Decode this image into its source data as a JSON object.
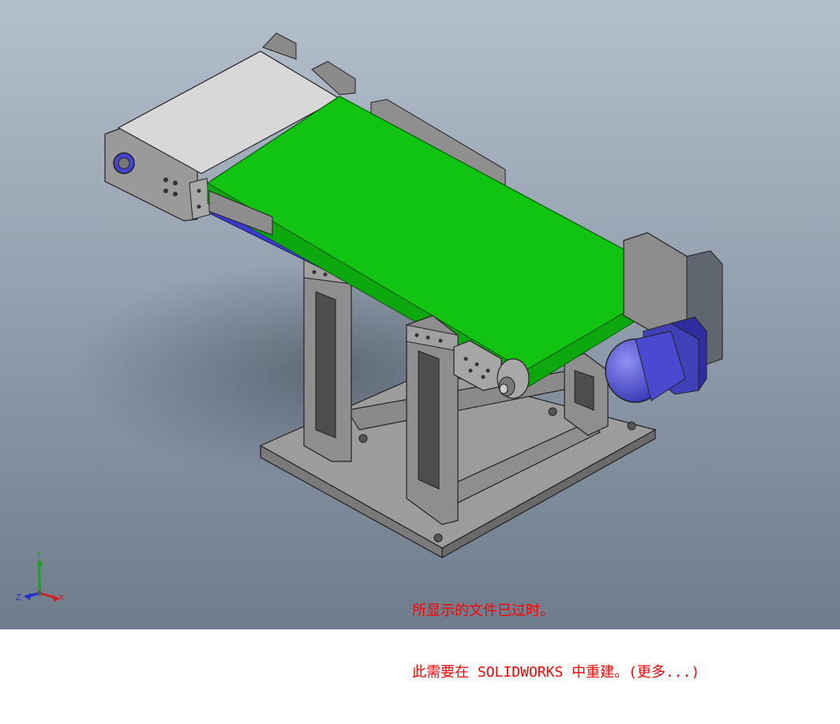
{
  "viewport": {
    "background_top": "#b4bfcc",
    "background_bottom": "#6e7c8c"
  },
  "model": {
    "belt_color": "#11c411",
    "frame_color": "#8a8a8a",
    "motor_color": "#5555dd",
    "rail_color": "#3a3acf"
  },
  "notice": {
    "line1": "所显示的文件已过时。",
    "line2": "此需要在 SOLIDWORKS 中重建。(更多...)",
    "color": "#ff0000"
  },
  "triad": {
    "x_label": "X",
    "y_label": "Y",
    "z_label": "Z",
    "x_color": "#d22020",
    "y_color": "#20a020",
    "z_color": "#2030d0"
  }
}
